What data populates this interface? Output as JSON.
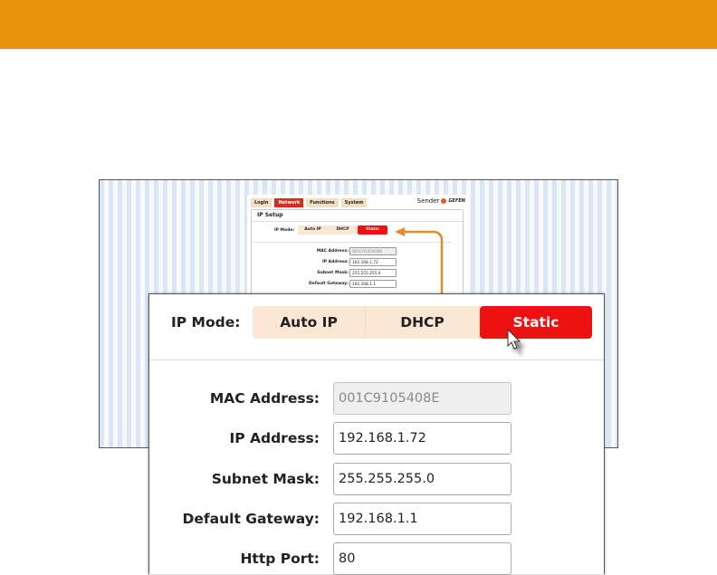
{
  "colors": {
    "banner": "#e8930a",
    "active_tab": "#e4281b",
    "static_button": "#ee1111",
    "inactive_button": "#fbe8d4",
    "arrow": "#e8892a"
  },
  "mini": {
    "tabs": [
      {
        "label": "Login",
        "active": false
      },
      {
        "label": "Network",
        "active": true
      },
      {
        "label": "Functions",
        "active": false
      },
      {
        "label": "System",
        "active": false
      }
    ],
    "brand_text": "Sender",
    "logo_text": "GEFEN",
    "section_title": "IP Setup",
    "ip_mode_label": "IP Mode:",
    "modes": [
      "Auto IP",
      "DHCP",
      "Static"
    ],
    "fields": [
      {
        "label": "MAC Address:",
        "value": "001C9105408E"
      },
      {
        "label": "IP Address:",
        "value": "192.168.1.72"
      },
      {
        "label": "Subnet Mask:",
        "value": "255.255.255.0"
      },
      {
        "label": "Default Gateway:",
        "value": "192.168.1.1"
      }
    ]
  },
  "zoom": {
    "ip_mode_label": "IP Mode:",
    "modes": {
      "auto": "Auto IP",
      "dhcp": "DHCP",
      "static": "Static"
    },
    "selected_mode": "Static",
    "fields": {
      "mac_label": "MAC Address:",
      "mac_value": "001C9105408E",
      "ip_label": "IP Address:",
      "ip_value": "192.168.1.72",
      "subnet_label": "Subnet Mask:",
      "subnet_value": "255.255.255.0",
      "gateway_label": "Default Gateway:",
      "gateway_value": "192.168.1.1",
      "port_label": "Http Port:",
      "port_value": "80"
    }
  },
  "icons": {
    "cursor": "mouse-pointer-icon",
    "arrow": "callout-arrow-icon"
  }
}
